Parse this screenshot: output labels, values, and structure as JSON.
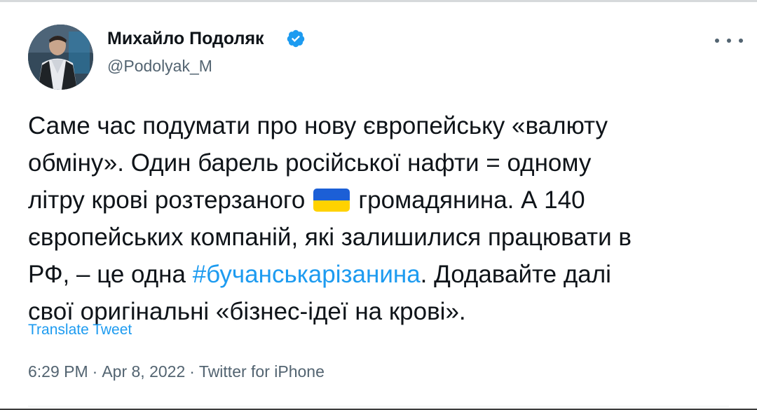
{
  "author": {
    "name": "Михайло Подоляк",
    "handle": "@Podolyak_M",
    "verified": true
  },
  "tweet": {
    "lines": [
      {
        "text": "Саме час подумати про нову європейську «валюту"
      },
      {
        "text": "обміну». Один барель російської нафти = одному"
      },
      {
        "before": "літру крові розтерзаного",
        "emoji": "ukraine-flag",
        "after": "громадянина. А 140"
      },
      {
        "text": "європейських компаній, які залишилися працювати в"
      },
      {
        "before": "РФ, – це одна ",
        "hashtag": "#бучанськарізанина",
        "after": ". Додавайте далі"
      },
      {
        "text": "свої оригінальні «бізнес-ідеї на крові»."
      }
    ]
  },
  "translate_label": "Translate Tweet",
  "meta": {
    "time": "6:29 PM",
    "date": "Apr 8, 2022",
    "source": "Twitter for iPhone",
    "separator": "·"
  },
  "icons": {
    "verified": "verified-badge-icon",
    "more": "more-options-icon",
    "flag": "ukraine-flag-emoji"
  },
  "colors": {
    "link": "#1d9bf0",
    "secondary_text": "#536471",
    "primary_text": "#0f1419",
    "flag_blue": "#1c5fd6",
    "flag_yellow": "#ffd200"
  }
}
